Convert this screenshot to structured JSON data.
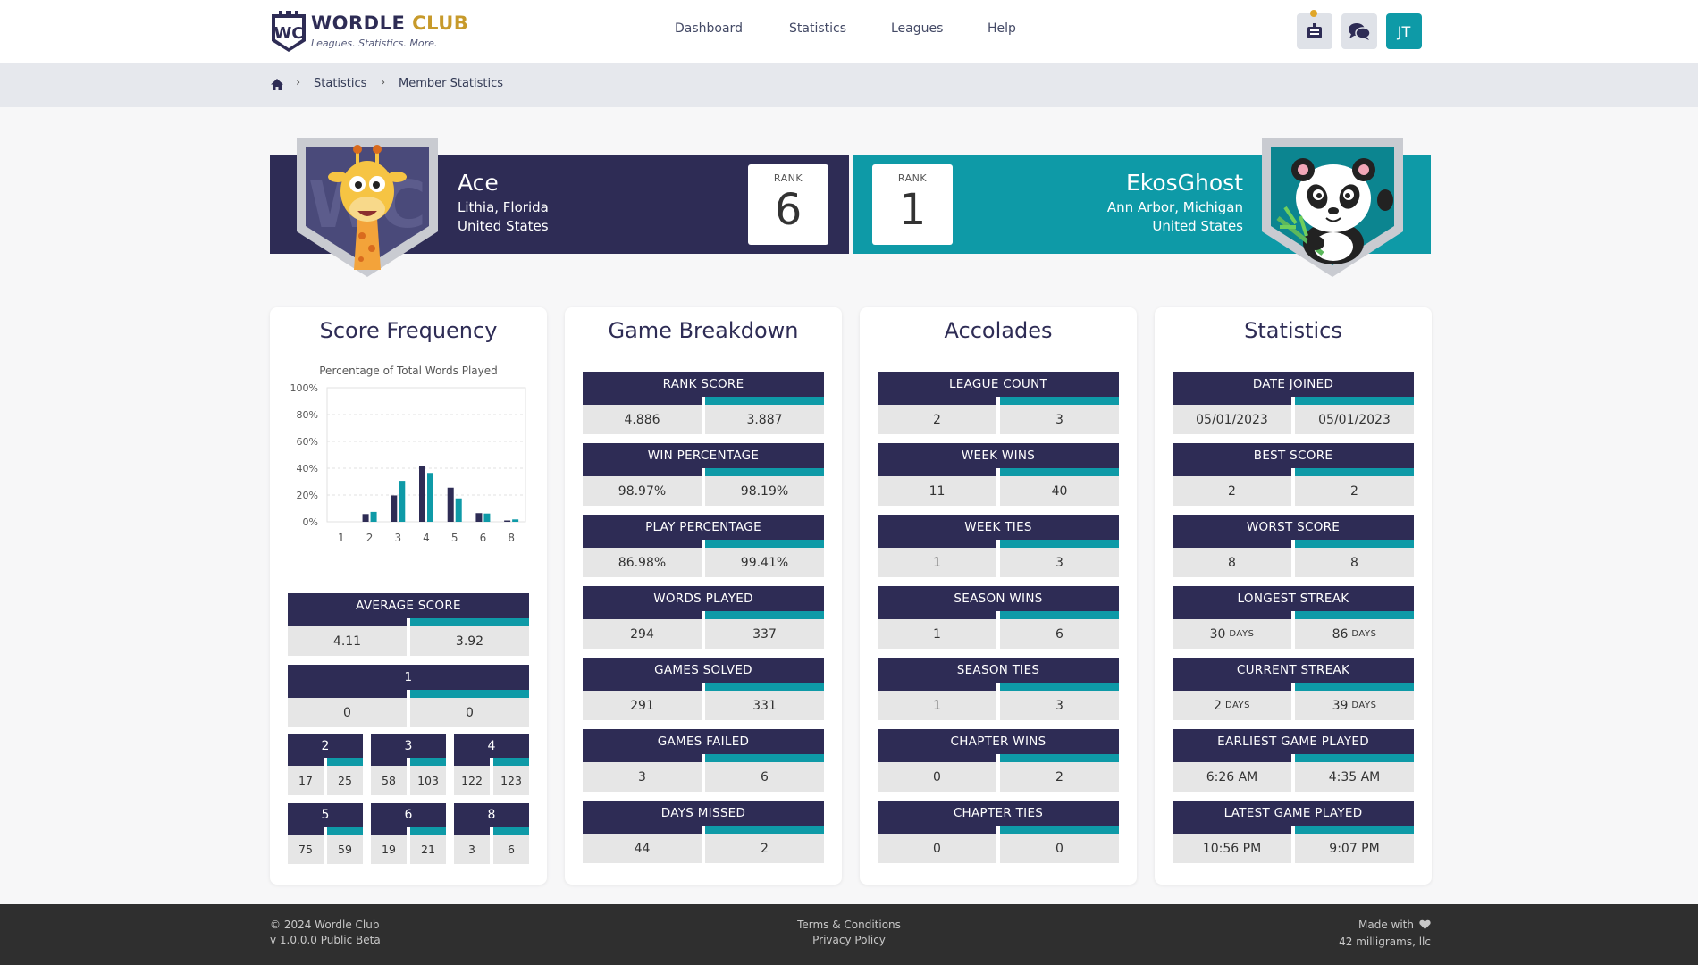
{
  "brand": {
    "name_part1": "WORDLE",
    "name_part2": "CLUB",
    "tagline": "Leagues. Statistics. More.",
    "monogram": "WC"
  },
  "nav": {
    "items": [
      "Dashboard",
      "Statistics",
      "Leagues",
      "Help"
    ],
    "avatar_initials": "JT"
  },
  "breadcrumb": {
    "items": [
      "Statistics",
      "Member Statistics"
    ]
  },
  "players": {
    "left": {
      "name": "Ace",
      "location_line1": "Lithia, Florida",
      "location_line2": "United States",
      "rank_label": "RANK",
      "rank": "6",
      "color": "#2e2c55"
    },
    "right": {
      "name": "EkosGhost",
      "location_line1": "Ann Arbor, Michigan",
      "location_line2": "United States",
      "rank_label": "RANK",
      "rank": "1",
      "color": "#0e9aa7"
    }
  },
  "score_frequency": {
    "title": "Score Frequency",
    "average": {
      "label": "AVERAGE SCORE",
      "a": "4.11",
      "b": "3.92"
    },
    "one": {
      "label": "1",
      "a": "0",
      "b": "0"
    },
    "tiles": [
      {
        "label": "2",
        "a": "17",
        "b": "25"
      },
      {
        "label": "3",
        "a": "58",
        "b": "103"
      },
      {
        "label": "4",
        "a": "122",
        "b": "123"
      },
      {
        "label": "5",
        "a": "75",
        "b": "59"
      },
      {
        "label": "6",
        "a": "19",
        "b": "21"
      },
      {
        "label": "8",
        "a": "3",
        "b": "6"
      }
    ]
  },
  "chart_data": {
    "type": "bar",
    "title": "Percentage of Total Words Played",
    "categories": [
      "1",
      "2",
      "3",
      "4",
      "5",
      "6",
      "8"
    ],
    "series": [
      {
        "color": "#2e2c55",
        "values": [
          0,
          5.8,
          19.7,
          41.5,
          25.5,
          6.5,
          1.0
        ]
      },
      {
        "color": "#0e9aa7",
        "values": [
          0,
          7.4,
          30.6,
          36.5,
          17.5,
          6.2,
          1.8
        ]
      }
    ],
    "ylim": [
      0,
      100
    ],
    "yticks": [
      "0%",
      "20%",
      "40%",
      "60%",
      "80%",
      "100%"
    ],
    "grid": true
  },
  "game_breakdown": {
    "title": "Game Breakdown",
    "stats": [
      {
        "label": "RANK SCORE",
        "a": "4.886",
        "b": "3.887"
      },
      {
        "label": "WIN PERCENTAGE",
        "a": "98.97%",
        "b": "98.19%"
      },
      {
        "label": "PLAY PERCENTAGE",
        "a": "86.98%",
        "b": "99.41%"
      },
      {
        "label": "WORDS PLAYED",
        "a": "294",
        "b": "337"
      },
      {
        "label": "GAMES SOLVED",
        "a": "291",
        "b": "331"
      },
      {
        "label": "GAMES FAILED",
        "a": "3",
        "b": "6"
      },
      {
        "label": "DAYS MISSED",
        "a": "44",
        "b": "2"
      }
    ]
  },
  "accolades": {
    "title": "Accolades",
    "stats": [
      {
        "label": "LEAGUE COUNT",
        "a": "2",
        "b": "3"
      },
      {
        "label": "WEEK WINS",
        "a": "11",
        "b": "40"
      },
      {
        "label": "WEEK TIES",
        "a": "1",
        "b": "3"
      },
      {
        "label": "SEASON WINS",
        "a": "1",
        "b": "6"
      },
      {
        "label": "SEASON TIES",
        "a": "1",
        "b": "3"
      },
      {
        "label": "CHAPTER WINS",
        "a": "0",
        "b": "2"
      },
      {
        "label": "CHAPTER TIES",
        "a": "0",
        "b": "0"
      }
    ]
  },
  "statistics": {
    "title": "Statistics",
    "unit_days": "DAYS",
    "stats": [
      {
        "label": "DATE JOINED",
        "a": "05/01/2023",
        "b": "05/01/2023"
      },
      {
        "label": "BEST SCORE",
        "a": "2",
        "b": "2"
      },
      {
        "label": "WORST SCORE",
        "a": "8",
        "b": "8"
      },
      {
        "label": "LONGEST STREAK",
        "a": "30",
        "b": "86"
      },
      {
        "label": "CURRENT STREAK",
        "a": "2",
        "b": "39"
      },
      {
        "label": "EARLIEST GAME PLAYED",
        "a": "6:26 AM",
        "b": "4:35 AM"
      },
      {
        "label": "LATEST GAME PLAYED",
        "a": "10:56 PM",
        "b": "9:07 PM"
      }
    ]
  },
  "footer": {
    "copyright": "© 2024 Wordle Club",
    "version": "v 1.0.0.0 Public Beta",
    "terms": "Terms & Conditions",
    "privacy": "Privacy Policy",
    "made_with": "Made with",
    "company": "42 milligrams, llc"
  }
}
